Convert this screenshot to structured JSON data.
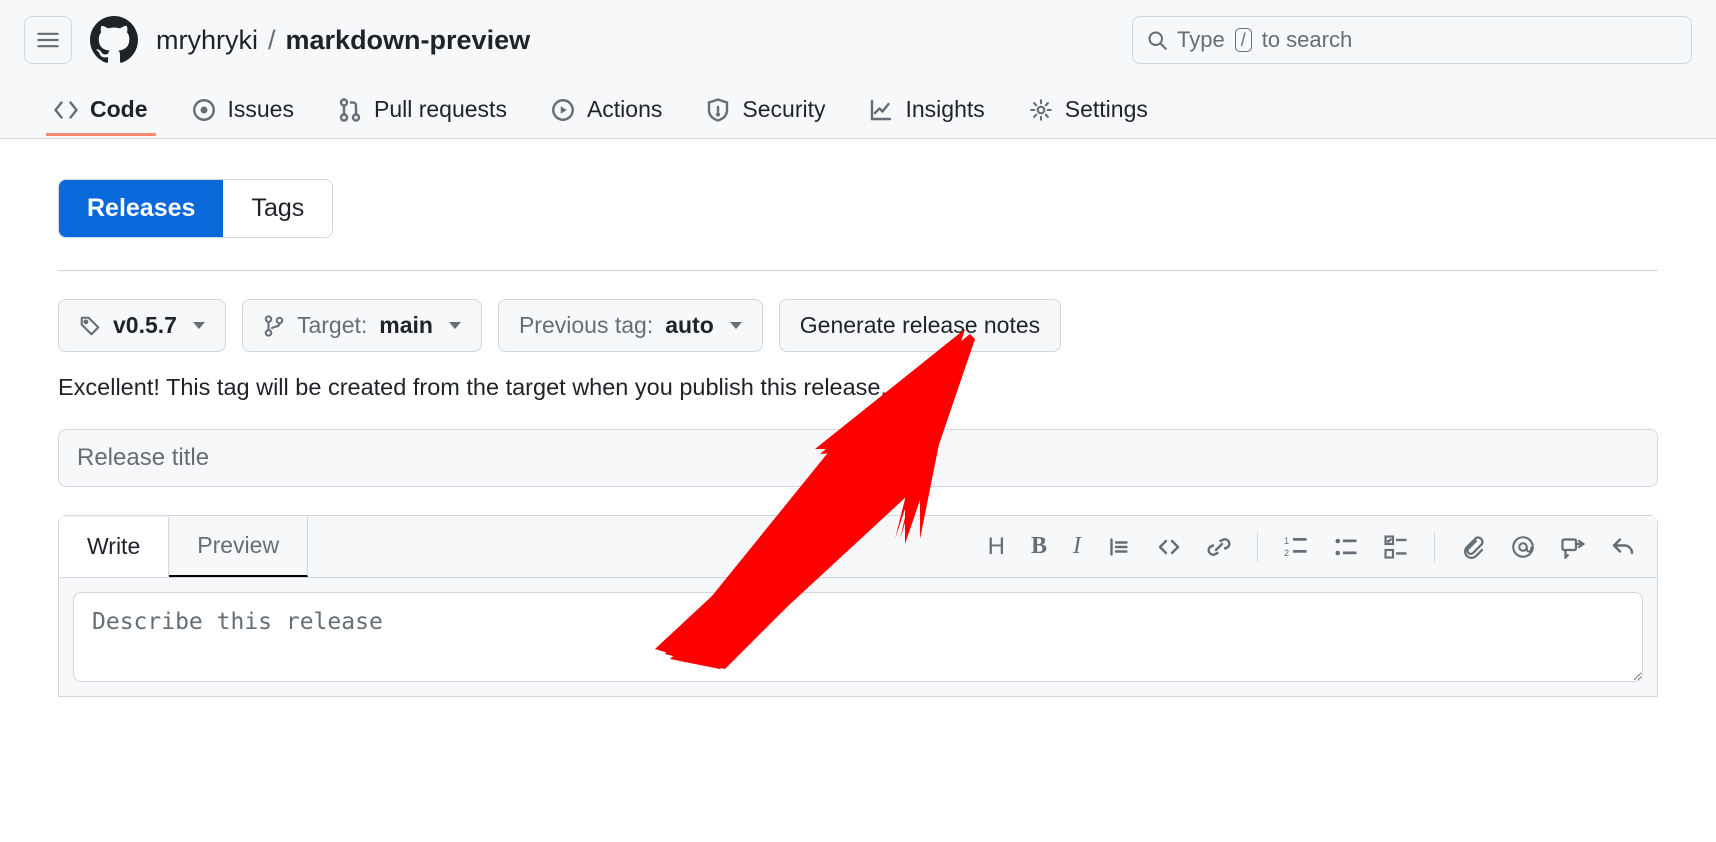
{
  "header": {
    "owner": "mryhryki",
    "repo": "markdown-preview",
    "search_prefix": "Type",
    "search_key": "/",
    "search_suffix": "to search"
  },
  "repo_nav": {
    "code": "Code",
    "issues": "Issues",
    "pulls": "Pull requests",
    "actions": "Actions",
    "security": "Security",
    "insights": "Insights",
    "settings": "Settings"
  },
  "subtabs": {
    "releases": "Releases",
    "tags": "Tags"
  },
  "release": {
    "tag": "v0.5.7",
    "target_label": "Target:",
    "target_value": "main",
    "previous_label": "Previous tag:",
    "previous_value": "auto",
    "generate": "Generate release notes",
    "hint": "Excellent! This tag will be created from the target when you publish this release.",
    "title_placeholder": "Release title"
  },
  "editor": {
    "write": "Write",
    "preview": "Preview",
    "description_placeholder": "Describe this release"
  }
}
